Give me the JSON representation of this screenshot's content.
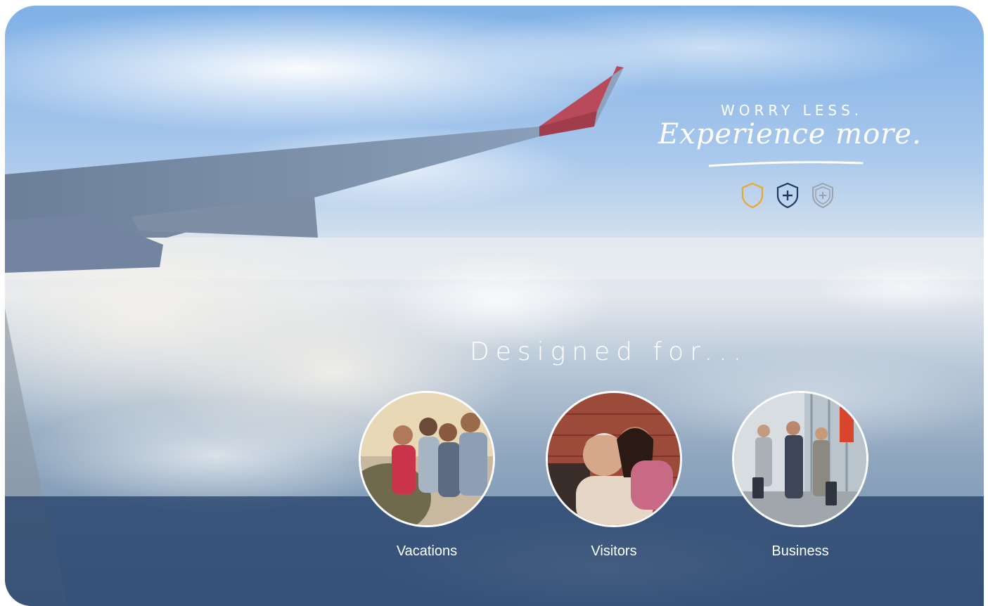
{
  "tagline": {
    "line1": "WORRY LESS.",
    "line2": "Experience more."
  },
  "shields": [
    {
      "icon": "shield-outline-icon",
      "color": "#e8a928"
    },
    {
      "icon": "shield-plus-icon",
      "color": "#1e3a64"
    },
    {
      "icon": "shield-double-plus-icon",
      "color": "#9aa3ad"
    }
  ],
  "heading": "Designed for...",
  "categories": [
    {
      "label": "Vacations"
    },
    {
      "label": "Visitors"
    },
    {
      "label": "Business"
    }
  ],
  "colors": {
    "band": "#1e3a64",
    "wing": "#5b6f8c",
    "wingtip": "#b84a5a"
  }
}
